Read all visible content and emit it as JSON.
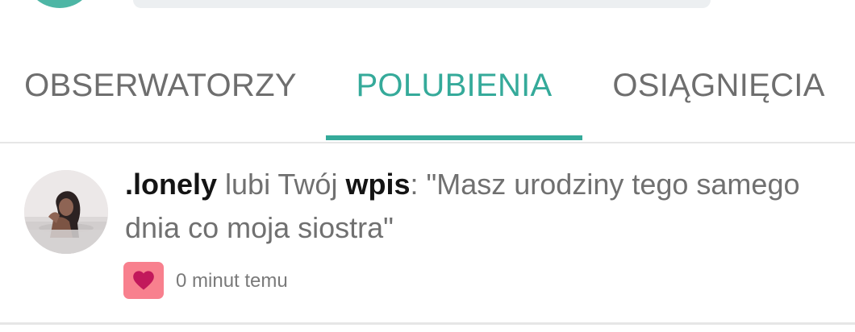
{
  "tabs": [
    {
      "label": "OBSERWATORZY"
    },
    {
      "label": "POLUBIENIA"
    },
    {
      "label": "OSIĄGNIĘCIA"
    }
  ],
  "active_tab": "POLUBIENIA",
  "colors": {
    "accent": "#35aa9a",
    "tab_inactive": "#6e6e6e",
    "heart_badge_bg": "#f8808e",
    "heart": "#c2185b"
  },
  "notification": {
    "username": ".lonely",
    "action": " lubi Twój ",
    "object": "wpis",
    "quote": ": \"Masz urodziny tego samego dnia co moja siostra\"",
    "time": "0 minut temu",
    "badge_icon": "heart-icon",
    "avatar_icon": "user-photo"
  }
}
